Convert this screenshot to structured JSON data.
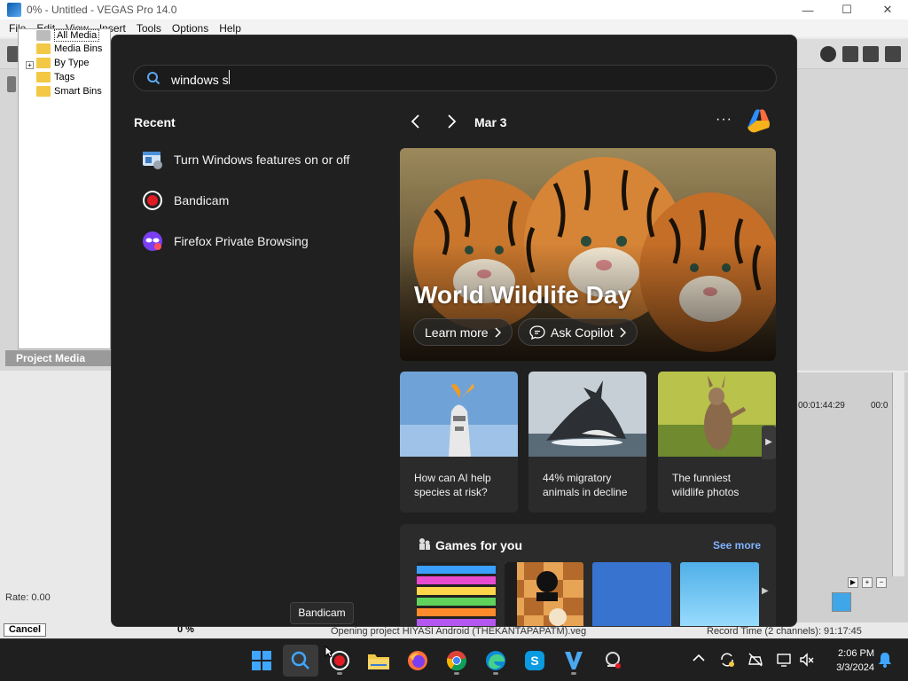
{
  "window": {
    "title": "0% - Untitled - VEGAS Pro 14.0",
    "min_label": "—",
    "max_label": "☐",
    "close_label": "✕"
  },
  "menu": [
    "File",
    "Edit",
    "View",
    "Insert",
    "Tools",
    "Options",
    "Help"
  ],
  "media_tree": {
    "items": [
      "All Media",
      "Media Bins",
      "By Type",
      "Tags",
      "Smart Bins"
    ],
    "expander": "+"
  },
  "project_media_label": "Project Media",
  "rate_label": "Rate: 0.00",
  "cancel_label": "Cancel",
  "progress_label": "0 %",
  "status_opening": "Opening project HIYASI Android (THEKANTAPAPATM).veg",
  "status_record": "Record Time (2 channels): 91:17:45",
  "timeline": {
    "time1": "00:01:44:29",
    "time2": "00:0"
  },
  "start": {
    "search_value": "windows s",
    "recent_title": "Recent",
    "recent": [
      {
        "label": "Turn Windows features on or off",
        "icon": "windows-features-icon"
      },
      {
        "label": "Bandicam",
        "icon": "bandicam-icon"
      },
      {
        "label": "Firefox Private Browsing",
        "icon": "firefox-private-icon"
      }
    ],
    "date": "Mar 3",
    "more_label": "···",
    "hero": {
      "title": "World Wildlife Day",
      "learn_more": "Learn more",
      "ask_copilot": "Ask Copilot"
    },
    "cards": [
      {
        "text": "How can AI help species at risk?"
      },
      {
        "text": "44% migratory animals in decline"
      },
      {
        "text": "The funniest wildlife photos"
      }
    ],
    "next_label": "▶",
    "games": {
      "title": "Games for you",
      "see_more": "See more"
    }
  },
  "tooltip": "Bandicam",
  "clock": {
    "time": "2:06 PM",
    "date": "3/3/2024"
  },
  "colors": {
    "start_bg": "#202020",
    "card_bg": "#2b2b2b",
    "accent": "#7fb3ff",
    "taskbar_bg": "#1f1f1f"
  }
}
